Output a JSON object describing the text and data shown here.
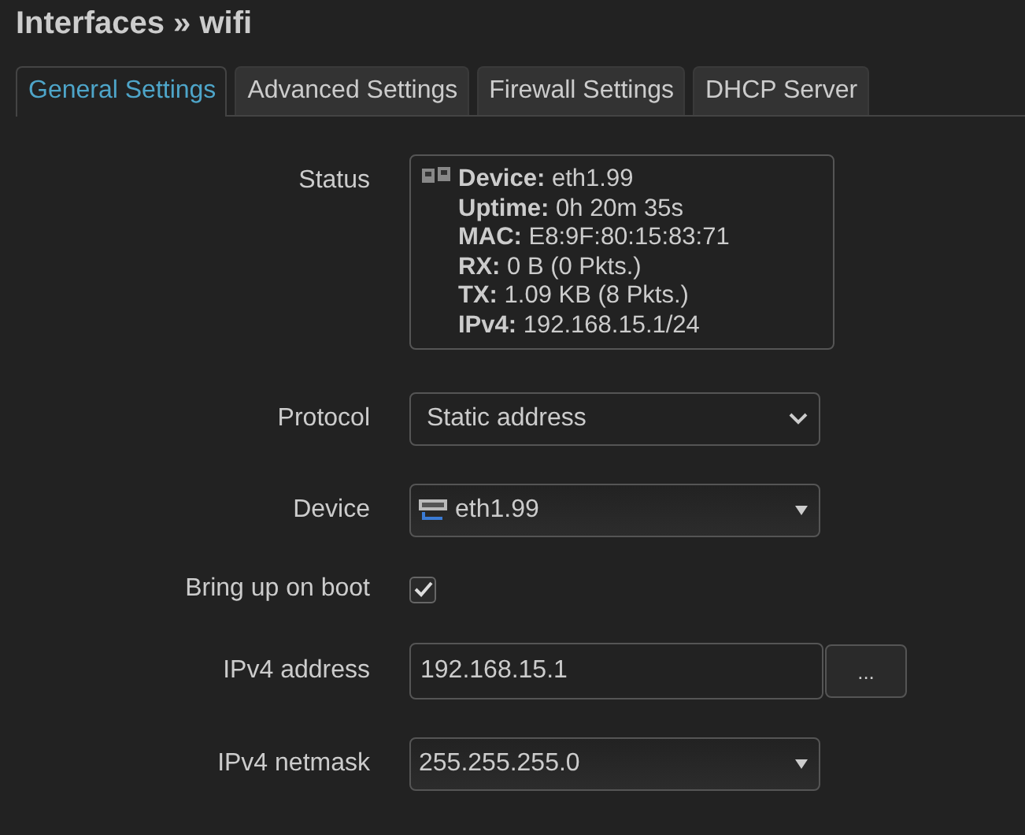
{
  "title": "Interfaces » wifi",
  "tabs": [
    {
      "label": "General Settings",
      "selected": true
    },
    {
      "label": "Advanced Settings",
      "selected": false
    },
    {
      "label": "Firewall Settings",
      "selected": false
    },
    {
      "label": "DHCP Server",
      "selected": false
    }
  ],
  "fields": [
    {
      "kind": "status",
      "label": "Status",
      "lines": [
        {
          "label": "Device:",
          "value": "eth1.99"
        },
        {
          "label": "Uptime:",
          "value": "0h 20m 35s"
        },
        {
          "label": "MAC:",
          "value": "E8:9F:80:15:83:71"
        },
        {
          "label": "RX:",
          "value": "0 B (0 Pkts.)"
        },
        {
          "label": "TX:",
          "value": "1.09 KB (8 Pkts.)"
        },
        {
          "label": "IPv4:",
          "value": "192.168.15.1/24"
        }
      ]
    },
    {
      "kind": "select",
      "label": "Protocol",
      "value": "Static address"
    },
    {
      "kind": "device",
      "label": "Device",
      "value": "eth1.99"
    },
    {
      "kind": "checkbox",
      "label": "Bring up on boot",
      "checked": true
    },
    {
      "kind": "text",
      "label": "IPv4 address",
      "value": "192.168.15.1",
      "button": "..."
    },
    {
      "kind": "combo",
      "label": "IPv4 netmask",
      "value": "255.255.255.0"
    }
  ]
}
